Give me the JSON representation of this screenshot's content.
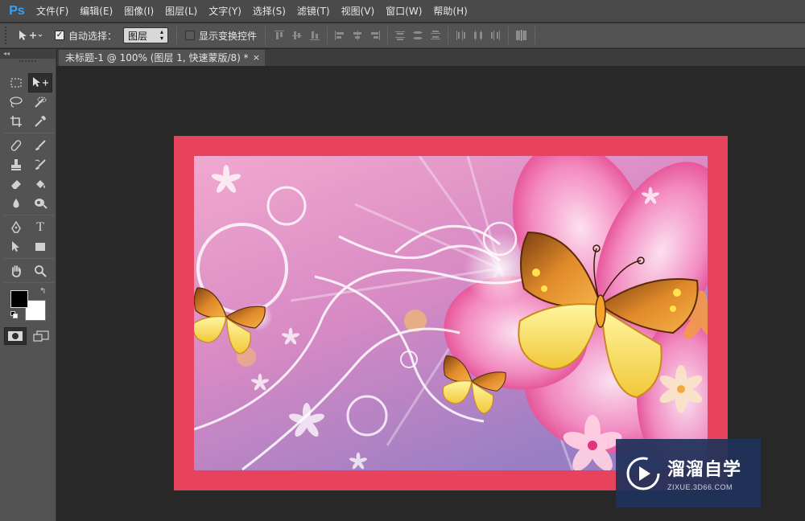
{
  "app": {
    "logo": "Ps"
  },
  "menu": [
    {
      "label": "文件(F)"
    },
    {
      "label": "编辑(E)"
    },
    {
      "label": "图像(I)"
    },
    {
      "label": "图层(L)"
    },
    {
      "label": "文字(Y)"
    },
    {
      "label": "选择(S)"
    },
    {
      "label": "滤镜(T)"
    },
    {
      "label": "视图(V)"
    },
    {
      "label": "窗口(W)"
    },
    {
      "label": "帮助(H)"
    }
  ],
  "options": {
    "auto_select_label": "自动选择：",
    "auto_select_checked": true,
    "auto_select_value": "图层",
    "show_transform_label": "显示变换控件",
    "show_transform_checked": false
  },
  "document": {
    "tab_title": "未标题-1 @ 100% (图层 1, 快速蒙版/8) *",
    "close_glyph": "×"
  },
  "tools": {
    "text_tool_glyph": "T"
  },
  "colors": {
    "foreground": "#000000",
    "background": "#ffffff",
    "canvas_border": "#e8435c",
    "accent": "#2fa3ff"
  },
  "watermark": {
    "name": "溜溜自学",
    "url": "ZIXUE.3D66.COM"
  }
}
